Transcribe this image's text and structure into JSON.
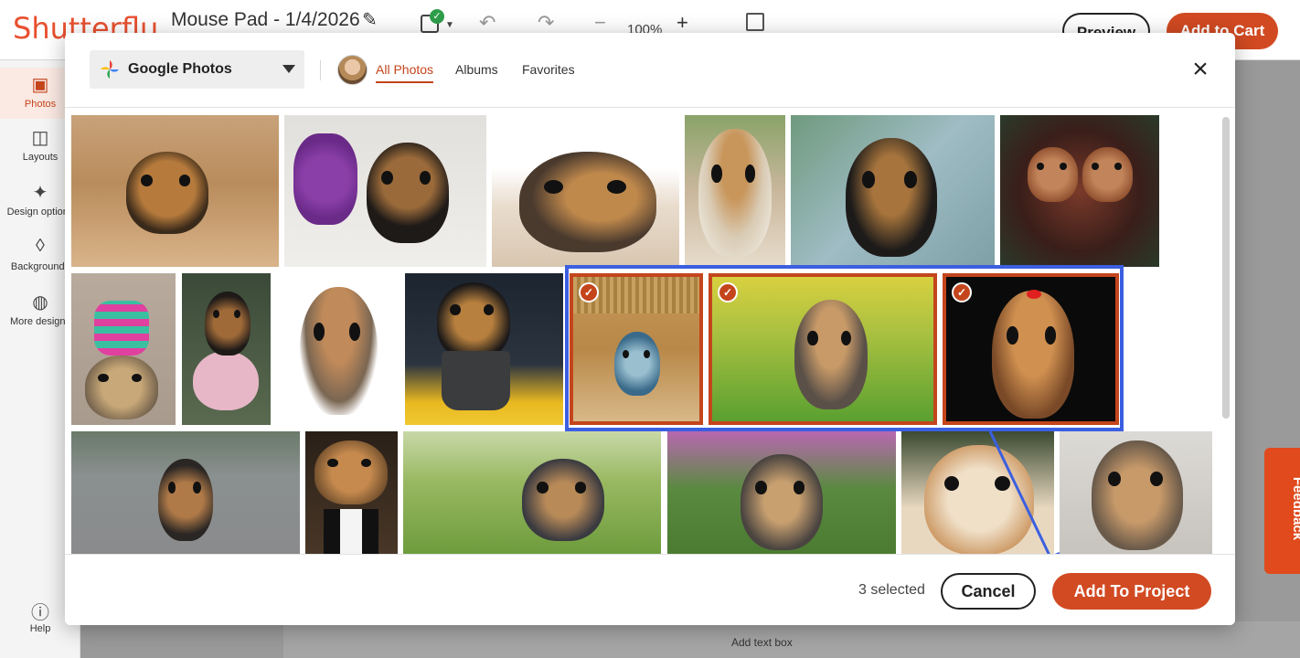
{
  "app": {
    "logo_text": "Shutterflu",
    "doc_title": "Mouse Pad - 1/4/2026",
    "zoom_text": "100%",
    "preview_label": "Preview",
    "add_to_cart_label": "Add to Cart",
    "add_text_box_label": "Add text box",
    "feedback_label": "Feedback"
  },
  "sidebar": {
    "items": [
      {
        "label": "Photos",
        "icon": "image-icon",
        "active": true
      },
      {
        "label": "Layouts",
        "icon": "layout-icon"
      },
      {
        "label": "Design options",
        "icon": "sparkle-icon"
      },
      {
        "label": "Backgrounds",
        "icon": "drop-icon"
      },
      {
        "label": "More designs",
        "icon": "palette-icon"
      }
    ],
    "help_label": "Help"
  },
  "modal": {
    "source_label": "Google Photos",
    "tabs": [
      {
        "label": "All Photos",
        "active": true
      },
      {
        "label": "Albums"
      },
      {
        "label": "Favorites"
      }
    ],
    "photos": [
      {
        "name": "photo-1"
      },
      {
        "name": "photo-2"
      },
      {
        "name": "photo-3"
      },
      {
        "name": "photo-4"
      },
      {
        "name": "photo-5"
      },
      {
        "name": "photo-6"
      },
      {
        "name": "photo-7"
      },
      {
        "name": "photo-8"
      },
      {
        "name": "photo-9"
      },
      {
        "name": "photo-10"
      },
      {
        "name": "photo-11",
        "selected": true
      },
      {
        "name": "photo-12",
        "selected": true
      },
      {
        "name": "photo-13",
        "selected": true
      },
      {
        "name": "photo-14"
      },
      {
        "name": "photo-15"
      },
      {
        "name": "photo-16"
      },
      {
        "name": "photo-17"
      },
      {
        "name": "photo-18"
      },
      {
        "name": "photo-19"
      }
    ],
    "selected_count_text": "3 selected",
    "cancel_label": "Cancel",
    "add_to_project_label": "Add To Project"
  },
  "colors": {
    "accent": "#d14a22",
    "annotation_blue": "#3b5fe0",
    "check_badge": "#c4451c"
  }
}
